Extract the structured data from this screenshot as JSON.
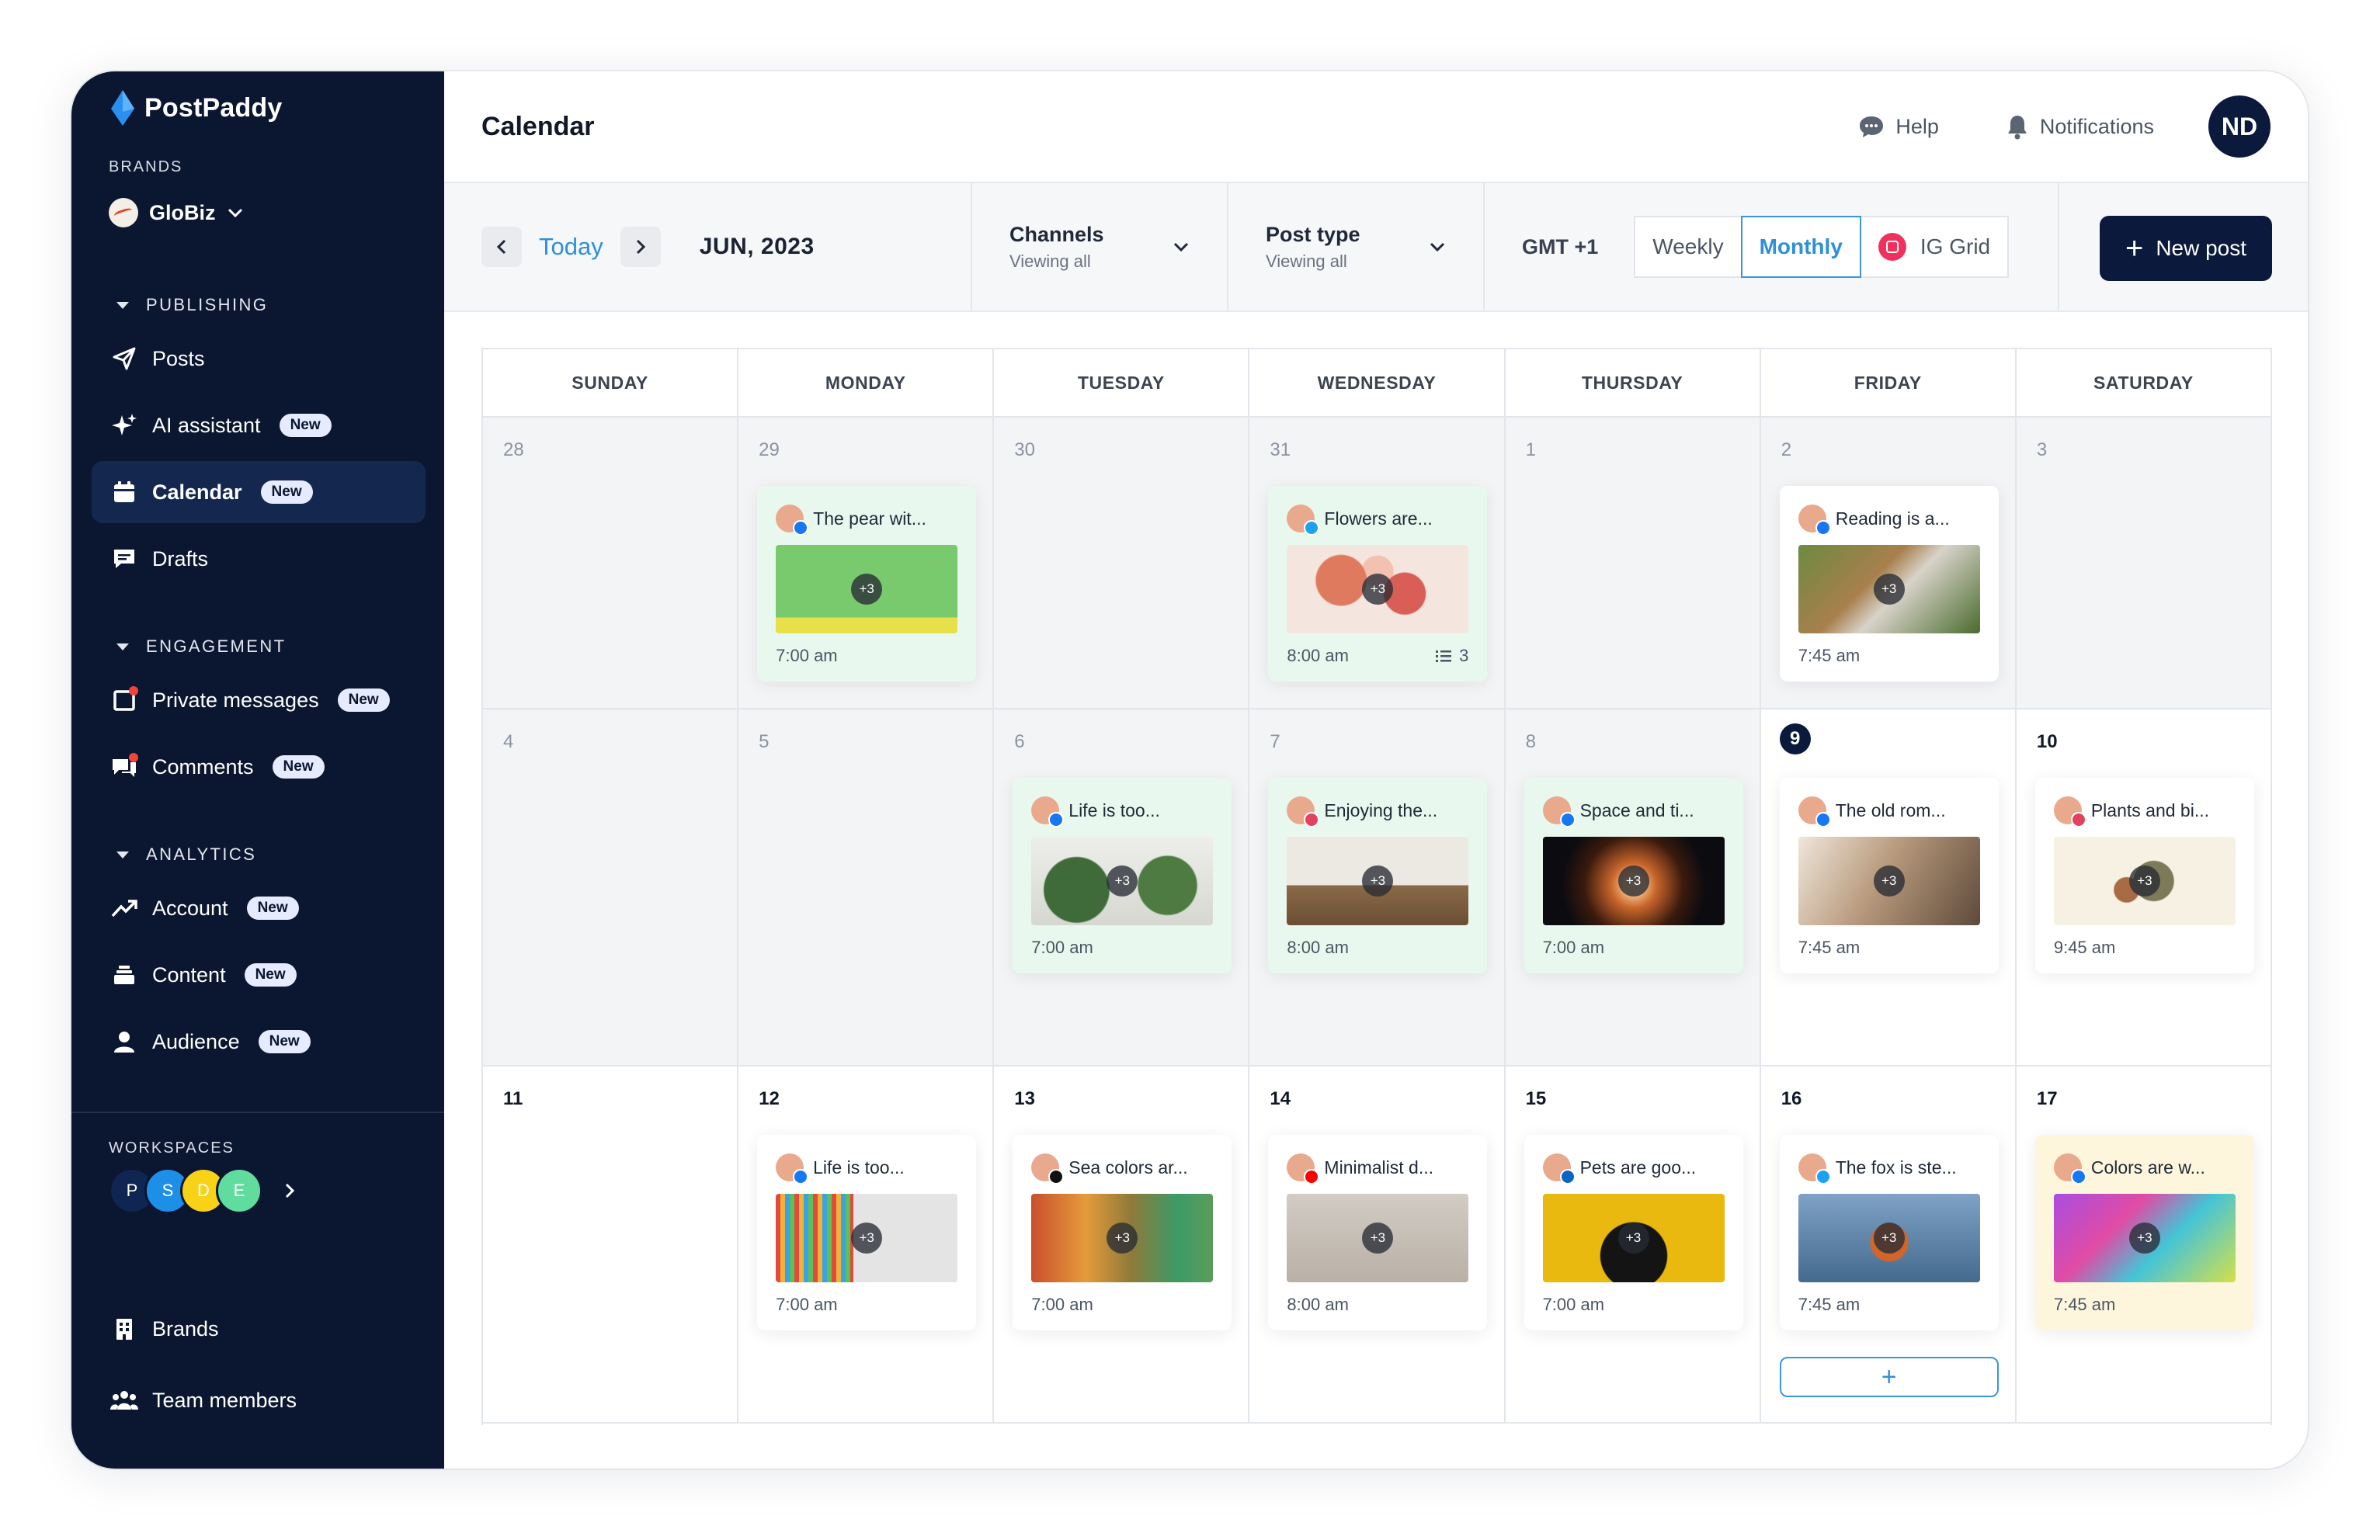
{
  "app": {
    "name": "PostPaddy"
  },
  "sidebar": {
    "brands_label": "BRANDS",
    "brand_name": "GloBiz",
    "groups": {
      "publishing": "PUBLISHING",
      "engagement": "ENGAGEMENT",
      "analytics": "ANALYTICS"
    },
    "items": {
      "posts": "Posts",
      "ai_assistant": "AI assistant",
      "calendar": "Calendar",
      "drafts": "Drafts",
      "private_messages": "Private messages",
      "comments": "Comments",
      "account": "Account",
      "content": "Content",
      "audience": "Audience",
      "brands": "Brands",
      "team_members": "Team members"
    },
    "new_badge": "New",
    "workspaces_label": "WORKSPACES",
    "workspaces": [
      "P",
      "S",
      "D",
      "E"
    ]
  },
  "header": {
    "title": "Calendar",
    "help": "Help",
    "notifications": "Notifications",
    "user_initials": "ND"
  },
  "toolbar": {
    "today": "Today",
    "month": "JUN, 2023",
    "channels_title": "Channels",
    "channels_sub": "Viewing all",
    "posttype_title": "Post type",
    "posttype_sub": "Viewing all",
    "timezone": "GMT +1",
    "view_weekly": "Weekly",
    "view_monthly": "Monthly",
    "view_ig": "IG Grid",
    "new_post": "New post"
  },
  "calendar": {
    "weekdays": [
      "SUNDAY",
      "MONDAY",
      "TUESDAY",
      "WEDNESDAY",
      "THURSDAY",
      "FRIDAY",
      "SATURDAY"
    ],
    "weeks": [
      [
        {
          "num": "28",
          "past": true
        },
        {
          "num": "29",
          "past": true,
          "post": {
            "title": "The pear wit...",
            "time": "7:00 am",
            "tone": "green",
            "img": "avocado",
            "net": "facebook"
          }
        },
        {
          "num": "30",
          "past": true
        },
        {
          "num": "31",
          "past": true,
          "post": {
            "title": "Flowers are...",
            "time": "8:00 am",
            "tone": "green",
            "img": "flowers",
            "net": "twitter",
            "count": "3"
          }
        },
        {
          "num": "1",
          "past": true
        },
        {
          "num": "2",
          "past": true,
          "post": {
            "title": "Reading is a...",
            "time": "7:45 am",
            "tone": "white",
            "img": "food",
            "net": "facebook"
          }
        },
        {
          "num": "3",
          "past": true
        }
      ],
      [
        {
          "num": "4",
          "past": true
        },
        {
          "num": "5",
          "past": true
        },
        {
          "num": "6",
          "past": true,
          "post": {
            "title": "Life is too...",
            "time": "7:00 am",
            "tone": "green",
            "img": "plants",
            "net": "facebook"
          }
        },
        {
          "num": "7",
          "past": true,
          "post": {
            "title": "Enjoying the...",
            "time": "8:00 am",
            "tone": "green",
            "img": "room",
            "net": "instagram"
          }
        },
        {
          "num": "8",
          "past": true,
          "post": {
            "title": "Space and ti...",
            "time": "7:00 am",
            "tone": "green",
            "img": "space",
            "net": "facebook"
          }
        },
        {
          "num": "9",
          "today": true,
          "post": {
            "title": "The old rom...",
            "time": "7:45 am",
            "tone": "white",
            "img": "statue",
            "net": "facebook"
          }
        },
        {
          "num": "10",
          "post": {
            "title": "Plants and bi...",
            "time": "9:45 am",
            "tone": "white",
            "img": "bird",
            "net": "instagram"
          }
        }
      ],
      [
        {
          "num": "11"
        },
        {
          "num": "12",
          "post": {
            "title": "Life is too...",
            "time": "7:00 am",
            "tone": "white",
            "img": "pencils",
            "net": "facebook"
          }
        },
        {
          "num": "13",
          "post": {
            "title": "Sea colors ar...",
            "time": "7:00 am",
            "tone": "white",
            "img": "wall",
            "net": "tiktok"
          }
        },
        {
          "num": "14",
          "post": {
            "title": "Minimalist d...",
            "time": "8:00 am",
            "tone": "white",
            "img": "chair",
            "net": "youtube"
          }
        },
        {
          "num": "15",
          "post": {
            "title": "Pets are goo...",
            "time": "7:00 am",
            "tone": "white",
            "img": "pug",
            "net": "linkedin"
          }
        },
        {
          "num": "16",
          "post": {
            "title": "The fox is ste...",
            "time": "7:45 am",
            "tone": "white",
            "img": "fox",
            "net": "twitter"
          },
          "add": true
        },
        {
          "num": "17",
          "post": {
            "title": "Colors are w...",
            "time": "7:45 am",
            "tone": "yellow",
            "img": "colors",
            "net": "facebook"
          }
        }
      ]
    ],
    "plus_more": "+3",
    "add_label": "+"
  },
  "colors": {
    "sidebar_bg": "#0b1630",
    "accent": "#2f8fd8",
    "primary_button": "#0b1a3c",
    "card_green": "#e9f8ee",
    "card_yellow": "#fdf6dc"
  }
}
